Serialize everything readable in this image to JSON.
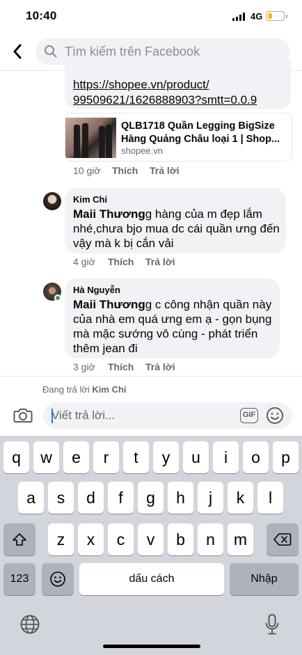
{
  "status_bar": {
    "time": "10:40",
    "network": "4G",
    "battery_level": 0.2
  },
  "search": {
    "placeholder": "Tìm kiếm trên Facebook"
  },
  "first_comment": {
    "link_line1": "https://shopee.vn/product/",
    "link_line2": "99509621/1626888903?smtt=0.0.9",
    "preview_title_line1": "QLB1718 Quần Legging BigSize",
    "preview_title_line2": "Hàng Quảng Châu loại 1 | Shop...",
    "preview_domain": "shopee.vn",
    "time": "10 giờ",
    "like": "Thích",
    "reply": "Trả lời"
  },
  "comments": [
    {
      "author": "Kim Chi",
      "mention": "Maii Thương",
      "lines": [
        "g hàng của m đẹp lắm",
        "nhé,chưa bjo mua dc cái quần ưng đến",
        "vậy mà k bị cắn vải"
      ],
      "time": "4 giờ",
      "like": "Thích",
      "reply": "Trả lời"
    },
    {
      "author": "Hà Nguyễn",
      "mention": "Maii Thương",
      "lines": [
        "g c công nhận quần này",
        "của nhà em quá ưng em ạ - gọn bụng",
        "mà mặc sướng vô cùng - phát triển",
        "thêm jean đi"
      ],
      "time": "3 giờ",
      "like": "Thích",
      "reply": "Trả lời"
    }
  ],
  "replying": {
    "prefix": "Đang trả lời",
    "name": "Kim Chi"
  },
  "composer": {
    "placeholder": "Viết trả lời...",
    "gif_label": "GIF"
  },
  "keyboard": {
    "row1": [
      "q",
      "w",
      "e",
      "r",
      "t",
      "y",
      "u",
      "i",
      "o",
      "p"
    ],
    "row2": [
      "a",
      "s",
      "d",
      "f",
      "g",
      "h",
      "j",
      "k",
      "l"
    ],
    "row3": [
      "z",
      "x",
      "c",
      "v",
      "b",
      "n",
      "m"
    ],
    "numbers_label": "123",
    "space_label": "dấu cách",
    "return_label": "Nhập"
  }
}
